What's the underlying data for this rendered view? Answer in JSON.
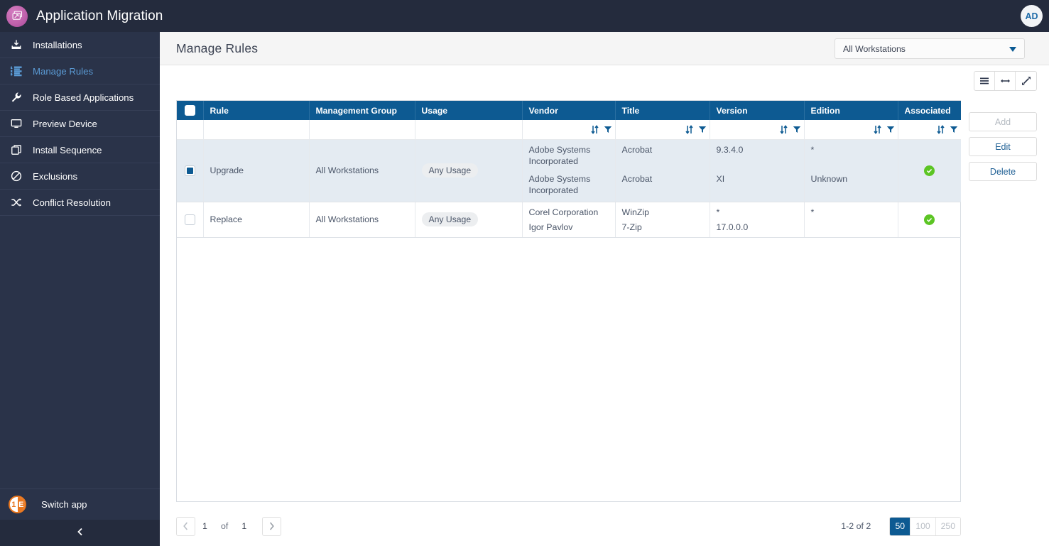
{
  "app": {
    "title": "Application Migration",
    "logo_icon": "windows-stack-icon",
    "avatar_initials": "AD"
  },
  "sidebar": {
    "items": [
      {
        "label": "Installations",
        "icon": "download-tray-icon",
        "active": false
      },
      {
        "label": "Manage Rules",
        "icon": "numbered-list-icon",
        "active": true
      },
      {
        "label": "Role Based Applications",
        "icon": "wrench-icon",
        "active": false
      },
      {
        "label": "Preview Device",
        "icon": "monitor-icon",
        "active": false
      },
      {
        "label": "Install Sequence",
        "icon": "copy-stack-icon",
        "active": false
      },
      {
        "label": "Exclusions",
        "icon": "ban-icon",
        "active": false
      },
      {
        "label": "Conflict Resolution",
        "icon": "shuffle-icon",
        "active": false
      }
    ],
    "switch_app": {
      "label": "Switch app",
      "logo_text_left": "1",
      "logo_text_right": "E"
    },
    "collapse_icon": "chevron-left-icon"
  },
  "header": {
    "page_title": "Manage Rules",
    "scope_select": {
      "value": "All Workstations",
      "caret_icon": "chevron-down-icon"
    }
  },
  "grid_tools": [
    {
      "name": "list-view-icon",
      "glyph": "menu-lines"
    },
    {
      "name": "fit-width-icon",
      "glyph": "arrows-horizontal"
    },
    {
      "name": "expand-icon",
      "glyph": "arrows-diagonal"
    }
  ],
  "actions": [
    {
      "label": "Add",
      "enabled": false
    },
    {
      "label": "Edit",
      "enabled": true
    },
    {
      "label": "Delete",
      "enabled": true
    }
  ],
  "table": {
    "columns": [
      {
        "label": "",
        "key": "select",
        "filterable": false
      },
      {
        "label": "Rule",
        "key": "rule",
        "filterable": false
      },
      {
        "label": "Management Group",
        "key": "management_group",
        "filterable": false
      },
      {
        "label": "Usage",
        "key": "usage",
        "filterable": false
      },
      {
        "label": "Vendor",
        "key": "vendor",
        "filterable": true
      },
      {
        "label": "Title",
        "key": "title",
        "filterable": true
      },
      {
        "label": "Version",
        "key": "version",
        "filterable": true
      },
      {
        "label": "Edition",
        "key": "edition",
        "filterable": true
      },
      {
        "label": "Associated",
        "key": "associated",
        "filterable": true
      }
    ],
    "filter_icons": {
      "sort": "sort-icon",
      "filter": "funnel-icon"
    },
    "select_all_checked": false,
    "rows": [
      {
        "selected": true,
        "rule": "Upgrade",
        "management_group": "All Workstations",
        "usage": "Any Usage",
        "entries": [
          {
            "vendor": "Adobe Systems Incorporated",
            "title": "Acrobat",
            "version": "9.3.4.0",
            "edition": "*"
          },
          {
            "vendor": "Adobe Systems Incorporated",
            "title": "Acrobat",
            "version": "XI",
            "edition": "Unknown"
          }
        ],
        "associated": true
      },
      {
        "selected": false,
        "rule": "Replace",
        "management_group": "All Workstations",
        "usage": "Any Usage",
        "entries": [
          {
            "vendor": "Corel Corporation",
            "title": "WinZip",
            "version": "*",
            "edition": "*"
          },
          {
            "vendor": "Igor Pavlov",
            "title": "7-Zip",
            "version": "17.0.0.0",
            "edition": ""
          }
        ],
        "associated": true
      }
    ]
  },
  "pager": {
    "prev_icon": "chevron-left-icon",
    "next_icon": "chevron-right-icon",
    "current_page": "1",
    "of_label": "of",
    "total_pages": "1",
    "range_text": "1-2 of 2",
    "page_sizes": [
      "50",
      "100",
      "250"
    ],
    "active_page_size": "50"
  },
  "colors": {
    "topbar": "#242b3d",
    "sidebar": "#2a3349",
    "accent_blue": "#0d5a92",
    "active_nav": "#5b9bd5",
    "success_green": "#5cc524",
    "selected_row": "#e4ebf2"
  }
}
